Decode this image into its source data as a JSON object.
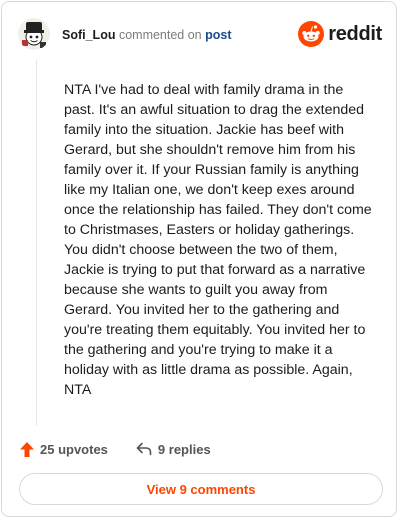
{
  "header": {
    "username": "Sofi_Lou",
    "action_text": "commented on",
    "target_text": "post",
    "brand": "reddit"
  },
  "comment": {
    "text": "NTA I've had to deal with family drama in the past. It's an awful situation to drag the extended family into the situation. Jackie has beef with Gerard, but she shouldn't remove him from his family over it. If your Russian family is anything like my Italian one, we don't keep exes around once the relationship has failed. They don't come to Christmases, Easters or holiday gatherings. You didn't choose between the two of them, Jackie is trying to put that forward as a narrative because she wants to guilt you away from Gerard. You invited her to the gathering and you're treating them equitably. You invited her to the gathering and you're trying to make it a holiday with as little drama as possible. Again, NTA"
  },
  "actions": {
    "upvotes_label": "25 upvotes",
    "replies_label": "9 replies"
  },
  "footer": {
    "view_comments_label": "View 9 comments"
  },
  "colors": {
    "accent": "#ff4500",
    "link": "#1a4b8c",
    "border": "#d7dadc"
  },
  "icons": [
    "snoo-avatar-icon",
    "reddit-logo-icon",
    "upvote-arrow-icon",
    "reply-arrow-icon"
  ]
}
